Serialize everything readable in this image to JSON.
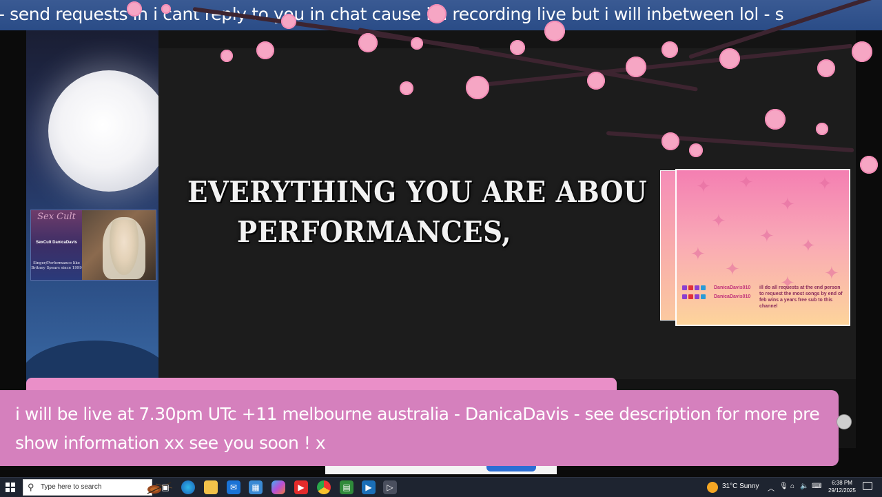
{
  "ticker": {
    "text": "- send requests  in               i cant reply to you in chat cause im recording live but i will inbetween lol - s"
  },
  "slide": {
    "line1": "EVERYTHING YOU ARE ABOU",
    "line2": "PERFORMANCES,"
  },
  "webcam": {
    "brand": "Sex Cult",
    "name": "SexCult DanicaDavis",
    "desc": "Singer/Performance like Britney Spears since 1999"
  },
  "chat": {
    "messages": [
      {
        "user": "DanicaDavis010",
        "text": "ill do all requests at the end person to request the most songs by end of feb wins a years free sub to this channel"
      },
      {
        "user": "DanicaDavis010",
        "text": ""
      }
    ]
  },
  "banner": {
    "text": "i will be live at 7.30pm UTc +11 melbourne australia - DanicaDavis - see description for more pre show information xx see you soon ! x"
  },
  "taskbar": {
    "search_placeholder": "Type here to search",
    "weather": "31°C  Sunny",
    "time": "6:38 PM",
    "date": "29/12/2025"
  }
}
